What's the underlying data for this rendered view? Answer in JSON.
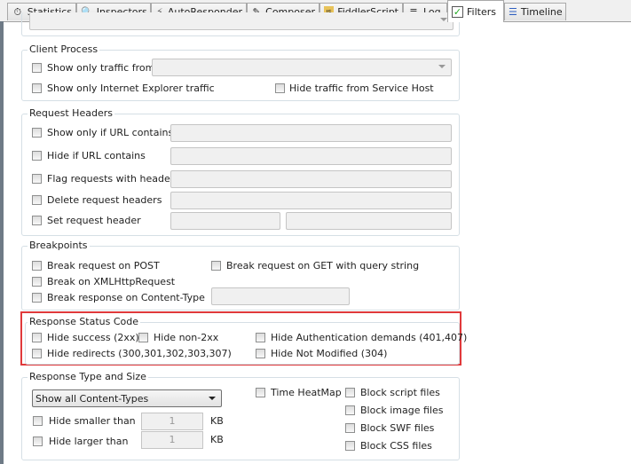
{
  "tabs": [
    {
      "label": "Statistics",
      "icon": "stopwatch-icon"
    },
    {
      "label": "Inspectors",
      "icon": "magnifier-icon"
    },
    {
      "label": "AutoResponder",
      "icon": "lightning-icon"
    },
    {
      "label": "Composer",
      "icon": "pencil-icon"
    },
    {
      "label": "FiddlerScript",
      "icon": "script-js-icon"
    },
    {
      "label": "Log",
      "icon": "document-icon"
    },
    {
      "label": "Filters",
      "icon": "checkbox-icon",
      "active": true
    },
    {
      "label": "Timeline",
      "icon": "timeline-icon"
    }
  ],
  "client_process": {
    "title": "Client Process",
    "show_only_from": "Show only traffic from",
    "show_only_ie": "Show only Internet Explorer traffic",
    "hide_service_host": "Hide traffic from Service Host"
  },
  "request_headers": {
    "title": "Request Headers",
    "url_contains": "Show only if URL contains",
    "hide_url": "Hide if URL contains",
    "flag_headers": "Flag requests with headers",
    "delete_headers": "Delete request headers",
    "set_header": "Set request header"
  },
  "breakpoints": {
    "title": "Breakpoints",
    "post": "Break request on POST",
    "get_query": "Break request on GET with query string",
    "xhr": "Break on XMLHttpRequest",
    "content_type": "Break response on Content-Type"
  },
  "status_code": {
    "title": "Response Status Code",
    "hide_success": "Hide success (2xx)",
    "hide_non2xx": "Hide non-2xx",
    "hide_auth": "Hide Authentication demands (401,407)",
    "hide_redirects": "Hide redirects (300,301,302,303,307)",
    "hide_not_modified": "Hide Not Modified (304)",
    "highlight_color": "#e0393b"
  },
  "response_type": {
    "title": "Response Type and Size",
    "content_types": "Show all Content-Types",
    "hide_smaller": "Hide smaller than",
    "hide_larger": "Hide larger than",
    "smaller_value": "1",
    "larger_value": "1",
    "unit": "KB",
    "heatmap": "Time HeatMap",
    "block_script": "Block script files",
    "block_image": "Block image files",
    "block_swf": "Block SWF files",
    "block_css": "Block CSS files"
  }
}
